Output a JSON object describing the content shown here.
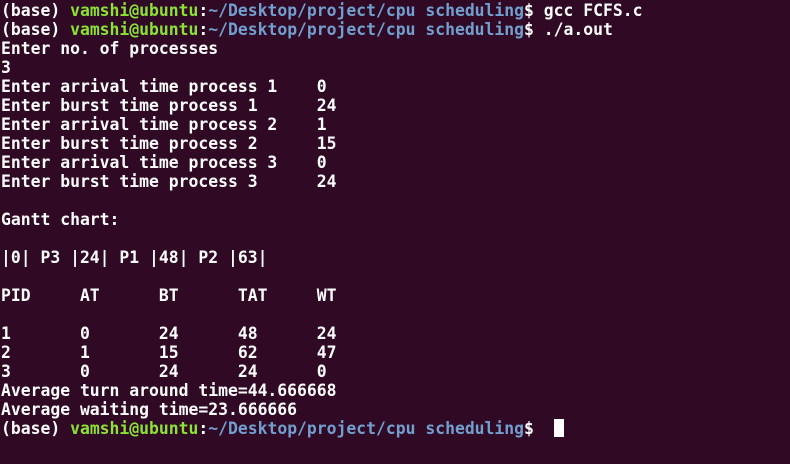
{
  "prompt": {
    "env": "(base) ",
    "user_host": "vamshi@ubuntu",
    "sep": ":",
    "path": "~/Desktop/project/cpu scheduling",
    "symbol": "$ "
  },
  "commands": [
    "gcc FCFS.c",
    "./a.out"
  ],
  "output": [
    "Enter no. of processes",
    "3",
    "Enter arrival time process 1    0",
    "Enter burst time process 1      24",
    "Enter arrival time process 2    1",
    "Enter burst time process 2      15",
    "Enter arrival time process 3    0",
    "Enter burst time process 3      24",
    "",
    "Gantt chart:",
    "",
    "|0| P3 |24| P1 |48| P2 |63|",
    "",
    "PID     AT      BT      TAT     WT",
    "",
    "1       0       24      48      24",
    "2       1       15      62      47",
    "3       0       24      24      0",
    "Average turn around time=44.666668",
    "Average waiting time=23.666666"
  ]
}
